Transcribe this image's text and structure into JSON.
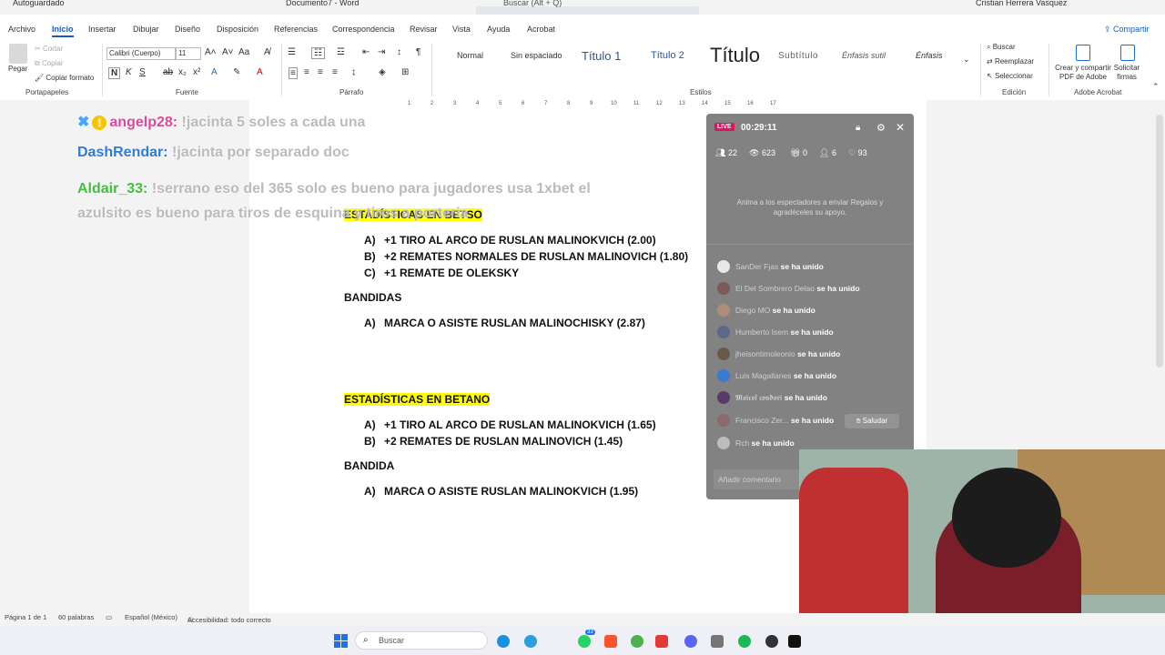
{
  "titlebar": {
    "autosave": "Autoguardado",
    "doc_title": "Documento7 - Word",
    "search_placeholder": "Buscar (Alt + Q)",
    "user": "Cristian Herrera Vasquez"
  },
  "menu": {
    "tabs": [
      "Archivo",
      "Inicio",
      "Insertar",
      "Dibujar",
      "Diseño",
      "Disposición",
      "Referencias",
      "Correspondencia",
      "Revisar",
      "Vista",
      "Ayuda",
      "Acrobat"
    ],
    "active": "Inicio",
    "share": "Compartir"
  },
  "ribbon": {
    "clipboard": {
      "paste": "Pegar",
      "cut": "Cortar",
      "copy": "Copiar",
      "format_painter": "Copiar formato",
      "label": "Portapapeles"
    },
    "font": {
      "name": "Calibri (Cuerpo)",
      "size": "11",
      "label": "Fuente"
    },
    "paragraph": {
      "label": "Párrafo"
    },
    "styles": {
      "items": [
        "Normal",
        "Sin espaciado",
        "Título 1",
        "Título 2",
        "Título",
        "Subtítulo",
        "Énfasis sutil",
        "Énfasis"
      ],
      "label": "Estilos"
    },
    "editing": {
      "find": "Buscar",
      "replace": "Reemplazar",
      "select": "Seleccionar",
      "label": "Edición"
    },
    "acrobat": {
      "create": "Crear y compartir PDF de Adobe",
      "sign": "Solicitar firmas",
      "label": "Adobe Acrobat"
    }
  },
  "ruler": {
    "ticks": [
      "1",
      "2",
      "3",
      "4",
      "5",
      "6",
      "7",
      "8",
      "9",
      "10",
      "11",
      "12",
      "13",
      "14",
      "15",
      "16",
      "17"
    ]
  },
  "chat_overlay": [
    {
      "user": "angelp28:",
      "message": "!jacinta 5 soles a cada una",
      "color": "#e0479a"
    },
    {
      "user": "DashRendar:",
      "message": "!jacinta por separado doc",
      "color": "#2a7be4"
    },
    {
      "user": "Aldair_33:",
      "message": "!serrano eso del 365 solo es bueno para jugadores usa 1xbet el azulsito es bueno para tiros de esquina y tiros a porteria",
      "color": "#3cc23c"
    }
  ],
  "document": {
    "heading1": "ESTADÍSTICAS EN BETSO",
    "betso_items": [
      {
        "letter": "A)",
        "text": "+1 TIRO AL ARCO DE RUSLAN MALINOKVICH (2.00)"
      },
      {
        "letter": "B)",
        "text": "+2 REMATES NORMALES DE RUSLAN MALINOVICH (1.80)"
      },
      {
        "letter": "C)",
        "text": "+1 REMATE DE OLEKSKY"
      }
    ],
    "bandidas_title": "BANDIDAS",
    "bandidas_items": [
      {
        "letter": "A)",
        "text": "MARCA O ASISTE RUSLAN MALINOCHISKY (2.87)"
      }
    ],
    "heading2": "ESTADÍSTICAS EN BETANO",
    "betano_items": [
      {
        "letter": "A)",
        "text": "+1 TIRO AL ARCO DE RUSLAN MALINOKVICH (1.65)"
      },
      {
        "letter": "B)",
        "text": "+2 REMATES DE RUSLAN MALINOVICH (1.45)"
      }
    ],
    "bandida_title": "BANDIDA",
    "bandida_items": [
      {
        "letter": "A)",
        "text": "MARCA O ASISTE RUSLAN MALINOKVICH (1.95)"
      }
    ]
  },
  "live_panel": {
    "badge": "LIVE",
    "timer": "00:29:11",
    "stats": {
      "viewers": "22",
      "views": "623",
      "gifts": "0",
      "followers": "6",
      "likes": "93"
    },
    "gift_prompt": "Anima a los espectadores a enviar Regalos y agradéceles su apoyo.",
    "joins": [
      {
        "name": "SanDer Fjas",
        "text": "se ha unido",
        "avatar": "#e8e8e8"
      },
      {
        "name": "El Del Sombrero Delao",
        "text": "se ha unido",
        "avatar": "#7a5a5a"
      },
      {
        "name": "Diego MO",
        "text": "se ha unido",
        "avatar": "#b08c7a"
      },
      {
        "name": "Humberto Isem",
        "text": "se ha unido",
        "avatar": "#5c6a8a"
      },
      {
        "name": "jheisontimoleonio",
        "text": "se ha unido",
        "avatar": "#6a5a4a"
      },
      {
        "name": "Luis Magallanes",
        "text": "se ha unido",
        "avatar": "#3a7ad0"
      },
      {
        "name": "𝕸𝖆𝖎𝖈𝖔𝖑 𝖈𝖔𝖓𝖉𝖔𝖗𝖎",
        "text": "se ha unido",
        "avatar": "#5a3a6a"
      },
      {
        "name": "Francisco Zer...",
        "text": "se ha unido",
        "avatar": "#8a6a6a"
      },
      {
        "name": "Rch",
        "text": "se ha unido",
        "avatar": "#bdbdbd"
      }
    ],
    "greet_button": "Saludar",
    "comment_placeholder": "Añadir comentario"
  },
  "statusbar": {
    "page": "Página 1 de 1",
    "words": "60 palabras",
    "language": "Español (México)",
    "accessibility": "Accesibilidad: todo correcto"
  },
  "taskbar": {
    "search": "Buscar",
    "badge": "33"
  }
}
